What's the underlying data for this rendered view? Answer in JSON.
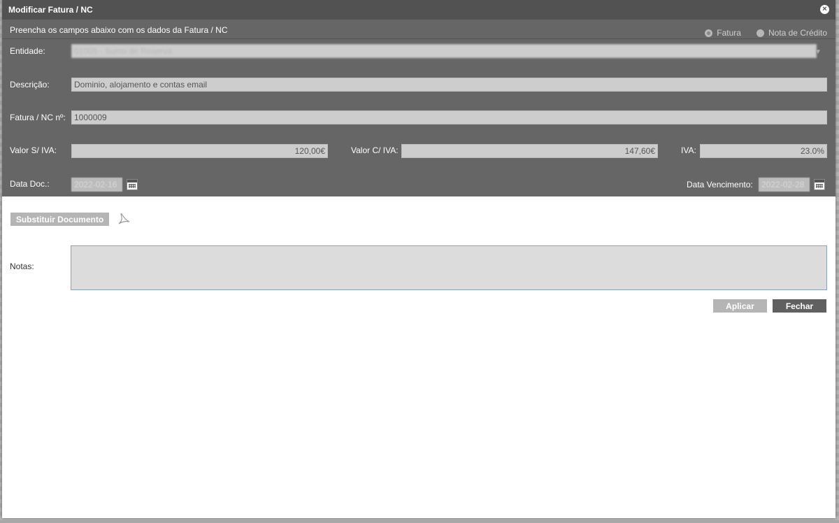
{
  "dialog": {
    "title": "Modificar Fatura / NC",
    "close_icon": "close-icon",
    "subtitle": "Preencha os campos abaixo com os dados da Fatura / NC"
  },
  "type_options": [
    {
      "label": "Fatura",
      "checked": true
    },
    {
      "label": "Nota de Crédito",
      "checked": false
    }
  ],
  "form": {
    "entidade_label": "Entidade:",
    "entidade_value": "01005 - Sumo de Reserva",
    "descricao_label": "Descrição:",
    "descricao_value": "Dominio, alojamento e contas email",
    "fatura_label": "Fatura / NC nº:",
    "fatura_value": "1000009",
    "valor_s_iva_label": "Valor S/ IVA:",
    "valor_s_iva_value": "120,00€",
    "valor_c_iva_label": "Valor C/ IVA:",
    "valor_c_iva_value": "147,60€",
    "iva_label": "IVA:",
    "iva_value": "23.0%",
    "data_doc_label": "Data Doc.:",
    "data_doc_value": "2022-02-16",
    "data_venc_label": "Data Vencimento:",
    "data_venc_value": "2022-02-28"
  },
  "actions": {
    "substituir_label": "Substituir Documento",
    "notas_label": "Notas:",
    "notas_value": "",
    "aplicar_label": "Aplicar",
    "fechar_label": "Fechar"
  },
  "colors": {
    "titlebar": "#525252",
    "form_bg": "#666666",
    "button_disabled": "#b5b5b5",
    "button_primary": "#606060"
  }
}
